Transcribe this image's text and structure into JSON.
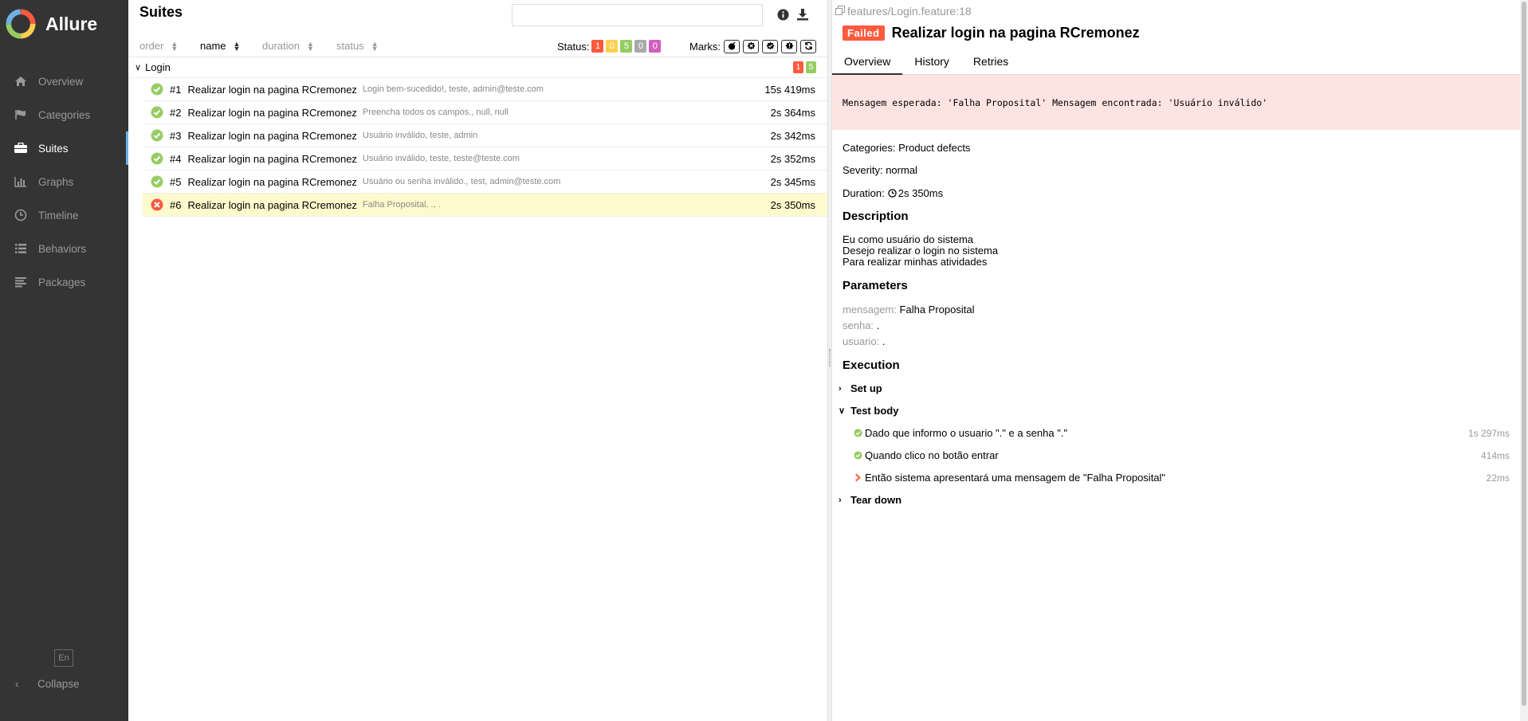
{
  "app": {
    "name": "Allure"
  },
  "sidebar": {
    "items": [
      {
        "label": "Overview",
        "icon": "home-icon",
        "active": false
      },
      {
        "label": "Categories",
        "icon": "flag-icon",
        "active": false
      },
      {
        "label": "Suites",
        "icon": "briefcase-icon",
        "active": true
      },
      {
        "label": "Graphs",
        "icon": "bar-chart-icon",
        "active": false
      },
      {
        "label": "Timeline",
        "icon": "clock-icon",
        "active": false
      },
      {
        "label": "Behaviors",
        "icon": "list-icon",
        "active": false
      },
      {
        "label": "Packages",
        "icon": "align-left-icon",
        "active": false
      }
    ],
    "language": "En",
    "collapse_label": "Collapse"
  },
  "suites": {
    "title": "Suites",
    "search": {
      "value": "",
      "placeholder": ""
    },
    "sort": {
      "order": "order",
      "name": "name",
      "duration": "duration",
      "status": "status"
    },
    "status_label": "Status:",
    "status_counts": {
      "failed": "1",
      "broken": "0",
      "passed": "5",
      "skipped": "0",
      "unknown": "0"
    },
    "marks_label": "Marks:",
    "group": {
      "name": "Login",
      "failed": "1",
      "passed": "5"
    },
    "rows": [
      {
        "num": "#1",
        "name": "Realizar login na pagina RCremonez",
        "params": "Login bem-sucedido!, teste, admin@teste.com",
        "duration": "15s 419ms",
        "status": "passed"
      },
      {
        "num": "#2",
        "name": "Realizar login na pagina RCremonez",
        "params": "Preencha todos os campos., null, null",
        "duration": "2s 364ms",
        "status": "passed"
      },
      {
        "num": "#3",
        "name": "Realizar login na pagina RCremonez",
        "params": "Usuário inválido, teste, admin",
        "duration": "2s 342ms",
        "status": "passed"
      },
      {
        "num": "#4",
        "name": "Realizar login na pagina RCremonez",
        "params": "Usuário inválido, teste, teste@teste.com",
        "duration": "2s 352ms",
        "status": "passed"
      },
      {
        "num": "#5",
        "name": "Realizar login na pagina RCremonez",
        "params": "Usuário ou senha inválido., test, admin@teste.com",
        "duration": "2s 345ms",
        "status": "passed"
      },
      {
        "num": "#6",
        "name": "Realizar login na pagina RCremonez",
        "params": "Falha Proposital, ., .",
        "duration": "2s 350ms",
        "status": "failed"
      }
    ]
  },
  "detail": {
    "path": "features/Login.feature:18",
    "status": "Failed",
    "title": "Realizar login na pagina RCremonez",
    "tabs": [
      "Overview",
      "History",
      "Retries"
    ],
    "error_message": "Mensagem esperada: 'Falha Proposital' Mensagem encontrada: 'Usuário inválido'",
    "categories_label": "Categories:",
    "categories_value": "Product defects",
    "severity_label": "Severity:",
    "severity_value": "normal",
    "duration_label": "Duration:",
    "duration_value": "2s 350ms",
    "description_heading": "Description",
    "description_lines": [
      "Eu como usuário do sistema",
      "Desejo realizar o login no sistema",
      "Para realizar minhas atividades"
    ],
    "parameters_heading": "Parameters",
    "parameters": [
      {
        "key": "mensagem:",
        "value": "Falha Proposital"
      },
      {
        "key": "senha:",
        "value": "."
      },
      {
        "key": "usuario:",
        "value": "."
      }
    ],
    "execution_heading": "Execution",
    "setup_label": "Set up",
    "test_body_label": "Test body",
    "steps": [
      {
        "name": "Dado que informo o usuario \".\" e a senha \".\"",
        "duration": "1s 297ms",
        "status": "passed"
      },
      {
        "name": "Quando clico no botão entrar",
        "duration": "414ms",
        "status": "passed"
      },
      {
        "name": "Então sistema apresentará uma mensagem de \"Falha Proposital\"",
        "duration": "22ms",
        "status": "failed"
      }
    ],
    "teardown_label": "Tear down"
  },
  "colors": {
    "sidebar_bg": "#343434",
    "failed": "#fd5a3e",
    "passed": "#97cc64",
    "broken": "#ffd050",
    "skipped": "#aaaaaa",
    "unknown": "#d35ebe",
    "accent": "#6eb1e6",
    "selected_row": "#fffacd"
  }
}
